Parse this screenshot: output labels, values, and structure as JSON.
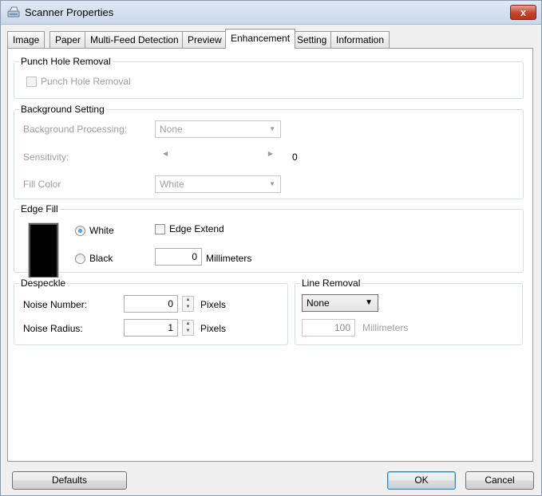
{
  "window": {
    "title": "Scanner Properties",
    "close_glyph": "x"
  },
  "tabs": [
    {
      "label": "Image"
    },
    {
      "label": "Paper"
    },
    {
      "label": "Multi-Feed Detection"
    },
    {
      "label": "Preview"
    },
    {
      "label": "Enhancement",
      "active": true
    },
    {
      "label": "Setting"
    },
    {
      "label": "Information"
    }
  ],
  "punch_hole": {
    "group_label": "Punch Hole Removal",
    "checkbox_label": "Punch Hole Removal",
    "checked": false
  },
  "background": {
    "group_label": "Background Setting",
    "processing_label": "Background Processing:",
    "processing_value": "None",
    "sensitivity_label": "Sensitivity:",
    "sensitivity_value": "0",
    "fill_color_label": "Fill Color",
    "fill_color_value": "White"
  },
  "edge_fill": {
    "group_label": "Edge Fill",
    "white_label": "White",
    "black_label": "Black",
    "selected": "White",
    "edge_extend_label": "Edge Extend",
    "edge_extend_checked": false,
    "millimeters_value": "0",
    "millimeters_label": "Millimeters"
  },
  "despeckle": {
    "group_label": "Despeckle",
    "noise_number_label": "Noise Number:",
    "noise_number_value": "0",
    "noise_radius_label": "Noise Radius:",
    "noise_radius_value": "1",
    "pixels_label": "Pixels"
  },
  "line_removal": {
    "group_label": "Line Removal",
    "mode_value": "None",
    "millimeters_value": "100",
    "millimeters_label": "Millimeters"
  },
  "buttons": {
    "defaults": "Defaults",
    "ok": "OK",
    "cancel": "Cancel"
  },
  "colors": {
    "accent": "#3c7fb1",
    "close_button": "#c2432b",
    "disabled_text": "#a0a0a0"
  }
}
